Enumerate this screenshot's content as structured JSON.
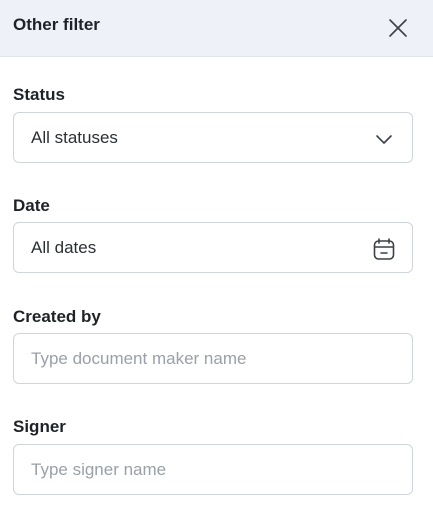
{
  "header": {
    "title": "Other filter",
    "close_icon": "close-icon"
  },
  "fields": {
    "status": {
      "label": "Status",
      "value": "All statuses",
      "icon": "chevron-down-icon"
    },
    "date": {
      "label": "Date",
      "value": "All dates",
      "icon": "calendar-icon"
    },
    "created_by": {
      "label": "Created by",
      "placeholder": "Type document maker name"
    },
    "signer": {
      "label": "Signer",
      "placeholder": "Type signer name"
    }
  },
  "colors": {
    "header_bg": "#eef2f8",
    "border": "#cfd5dd",
    "placeholder": "#9aa0a8",
    "text": "#1f2328"
  }
}
